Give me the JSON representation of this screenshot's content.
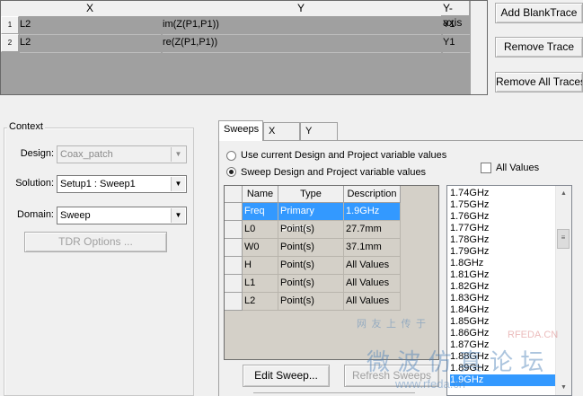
{
  "trace_grid": {
    "columns": [
      "X",
      "Y",
      "Y-axis"
    ],
    "rows": [
      {
        "num": "1",
        "x": "L2",
        "y": "im(Z(P1,P1))",
        "axis": "Y1"
      },
      {
        "num": "2",
        "x": "L2",
        "y": "re(Z(P1,P1))",
        "axis": "Y1"
      }
    ]
  },
  "trace_buttons": {
    "add_blank": "Add BlankTrace",
    "remove_trace": "Remove Trace",
    "remove_all": "Remove All Traces"
  },
  "context": {
    "title": "Context",
    "design_label": "Design:",
    "design_value": "Coax_patch",
    "solution_label": "Solution:",
    "solution_value": "Setup1 : Sweep1",
    "domain_label": "Domain:",
    "domain_value": "Sweep",
    "tdr_button": "TDR Options ..."
  },
  "tabs": [
    "Sweeps",
    "X",
    "Y"
  ],
  "sweeps": {
    "radio_current": "Use current Design and Project variable values",
    "radio_sweep": "Sweep Design and Project variable values",
    "all_values_label": "All Values",
    "table_headers": [
      "Name",
      "Type",
      "Description"
    ],
    "table_rows": [
      {
        "name": "Freq",
        "type": "Primary Sweep",
        "desc": "1.9GHz"
      },
      {
        "name": "L0",
        "type": "Point(s)",
        "desc": "27.7mm"
      },
      {
        "name": "W0",
        "type": "Point(s)",
        "desc": "37.1mm"
      },
      {
        "name": "H",
        "type": "Point(s)",
        "desc": "All Values"
      },
      {
        "name": "L1",
        "type": "Point(s)",
        "desc": "All Values"
      },
      {
        "name": "L2",
        "type": "Point(s)",
        "desc": "All Values"
      }
    ],
    "values": [
      "1.74GHz",
      "1.75GHz",
      "1.76GHz",
      "1.77GHz",
      "1.78GHz",
      "1.79GHz",
      "1.8GHz",
      "1.81GHz",
      "1.82GHz",
      "1.83GHz",
      "1.84GHz",
      "1.85GHz",
      "1.86GHz",
      "1.87GHz",
      "1.88GHz",
      "1.89GHz",
      "1.9GHz"
    ],
    "selected_value": "1.9GHz",
    "edit_button": "Edit Sweep...",
    "refresh_button": "Refresh Sweeps"
  },
  "watermark": {
    "line1": "网 友 上 传 于",
    "brand": "RFEDA.CN",
    "big": "微 波 仿 真 论 坛",
    "url": "www.rfeda.cn"
  },
  "colors": {
    "selection": "#3399ff",
    "grid_bg": "#a0a0a0"
  }
}
